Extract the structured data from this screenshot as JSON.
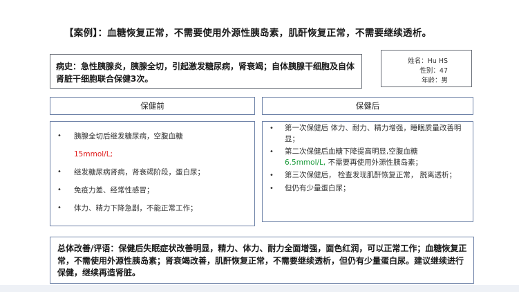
{
  "title": "【案例】：血糖恢复正常，不需要使用外源性胰岛素，肌酐恢复正常，不需要继续透析。",
  "history": "病史：急性胰腺炎，胰腺全切，引起激发糖尿病，肾衰竭；自体胰腺干细胞及自体肾脏干细胞联合保健3次。",
  "patient": {
    "name": "姓名：Hu HS",
    "gender": "性别：47",
    "age": "年龄：男"
  },
  "before": {
    "header": "保健前",
    "items": [
      {
        "text": "胰腺全切后继发糖尿病，空腹血糖",
        "highlight": "15mmol/L;",
        "tail": ""
      },
      {
        "text": "继发糖尿病肾病，肾衰竭阶段，蛋白尿；"
      },
      {
        "text": "免疫力差、经常性感冒；"
      },
      {
        "text": "体力、精力下降急剧，不能正常工作；"
      }
    ]
  },
  "after": {
    "header": "保健后",
    "items": [
      {
        "text": "第一次保健后 体力、耐力、精力增强，睡眠质量改善明显；"
      },
      {
        "text": "第二次保健后血糖下降提高明显,空腹血糖",
        "highlight": "6.5mmol/L,",
        "tail": " 不需要再使用外源性胰岛素；"
      },
      {
        "text": "第三次保健后， 检查发现肌酐恢复正常， 脱离透析；"
      },
      {
        "text": "但仍有少量蛋白尿；"
      }
    ]
  },
  "summary": "总体改善/评语：保健后失眠症状改善明显，精力、体力、耐力全面增强，面色红润，可以正常工作；血糖恢复正常，不需使用外源性胰岛素；肾衰竭改善，肌酐恢复正常，不需要继续透析，但仍有少量蛋白尿。建议继续进行保健，继续再造肾脏。"
}
